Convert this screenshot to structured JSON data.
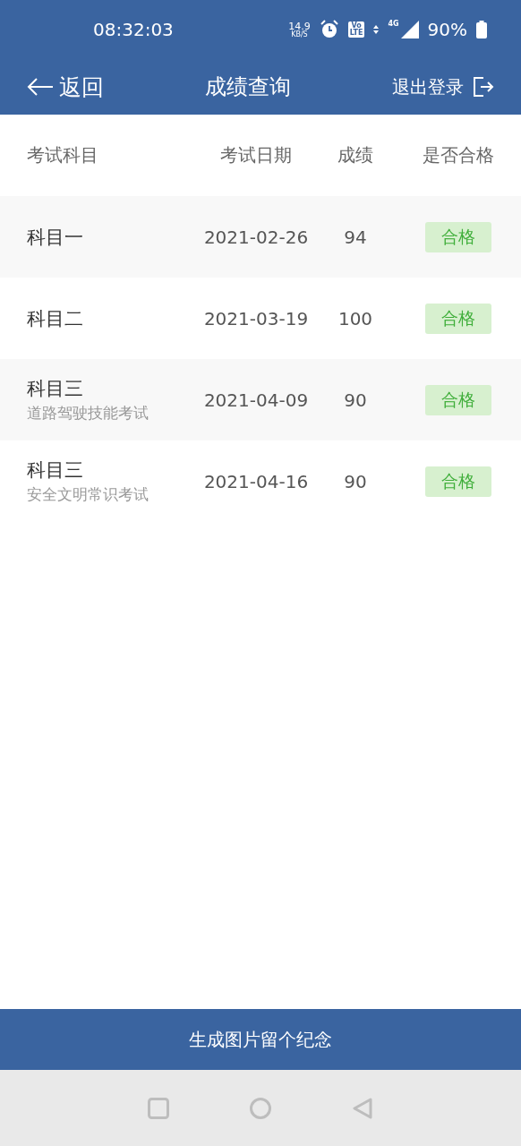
{
  "status_bar": {
    "time": "08:32:03",
    "speed": "14.9",
    "speed_unit": "KB/S",
    "volte_top": "Vo",
    "volte_bottom": "LTE",
    "network": "4G",
    "battery": "90%"
  },
  "header": {
    "back": "返回",
    "title": "成绩查询",
    "logout": "退出登录"
  },
  "table": {
    "columns": [
      "考试科目",
      "考试日期",
      "成绩",
      "是否合格"
    ],
    "rows": [
      {
        "subject": "科目一",
        "date": "2021-02-26",
        "score": "94",
        "result": "合格",
        "passed": true
      },
      {
        "subject": "科目二",
        "date": "2021-03-19",
        "score": "100",
        "result": "合格",
        "passed": true
      },
      {
        "subject": "科目三",
        "subtitle": "道路驾驶技能考试",
        "date": "2021-04-09",
        "score": "90",
        "result": "合格",
        "passed": true
      },
      {
        "subject": "科目三",
        "subtitle": "安全文明常识考试",
        "date": "2021-04-16",
        "score": "90",
        "result": "合格",
        "passed": true
      }
    ]
  },
  "bottom_button": "生成图片留个纪念"
}
